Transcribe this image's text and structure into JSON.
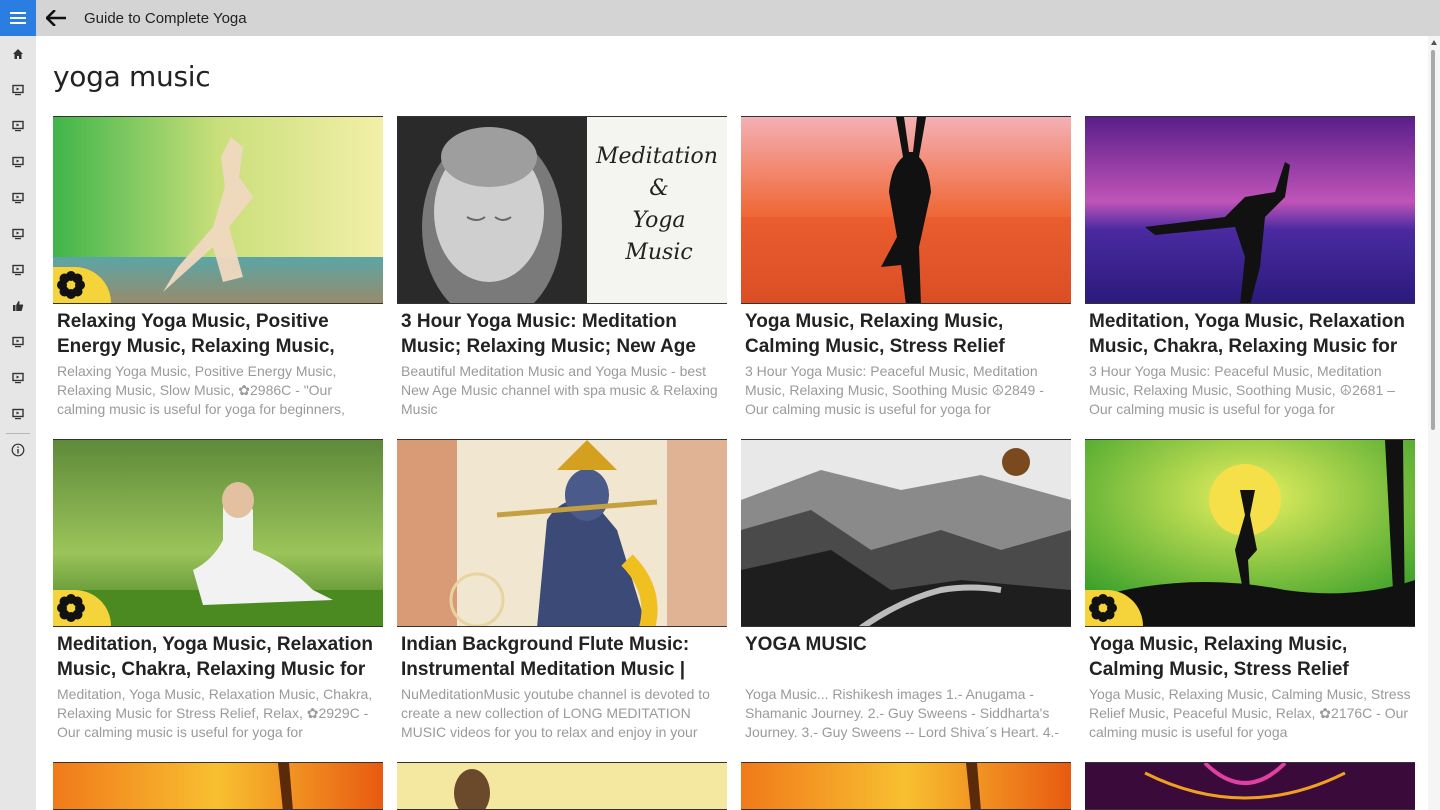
{
  "window": {
    "title": "Guide to Complete Yoga"
  },
  "nav": {
    "icons": [
      "home-icon",
      "video-icon",
      "video-icon",
      "video-icon",
      "video-icon",
      "video-icon",
      "video-icon",
      "thumbs-up-icon",
      "video-icon",
      "video-icon",
      "video-icon",
      "info-icon"
    ]
  },
  "page": {
    "title": "yoga music"
  },
  "cards": [
    {
      "title": "Relaxing Yoga Music, Positive Energy Music, Relaxing Music, Slow",
      "desc": "Relaxing Yoga Music, Positive Energy Music, Relaxing Music, Slow Music, ✿2986C - \"Our calming music is useful for yoga for beginners,"
    },
    {
      "title": "3 Hour Yoga Music: Meditation Music; Relaxing Music; New Age",
      "desc": "Beautiful Meditation Music and Yoga Music - best New Age Music channel with spa music & Relaxing Music"
    },
    {
      "title": "Yoga Music, Relaxing Music, Calming Music, Stress Relief Music,",
      "desc": "3 Hour Yoga Music: Peaceful Music, Meditation Music, Relaxing Music, Soothing Music ☮2849 - Our calming music is useful for yoga for"
    },
    {
      "title": "Meditation, Yoga Music, Relaxation Music, Chakra, Relaxing Music for",
      "desc": "3 Hour Yoga Music: Peaceful Music, Meditation Music, Relaxing Music, Soothing Music, ☮2681 – Our calming music is useful for yoga for"
    },
    {
      "title": "Meditation, Yoga Music, Relaxation Music, Chakra, Relaxing Music for",
      "desc": "Meditation, Yoga Music, Relaxation Music, Chakra, Relaxing Music for Stress Relief, Relax, ✿2929C - Our calming music is useful for yoga for"
    },
    {
      "title": "Indian Background Flute Music: Instrumental Meditation Music |",
      "desc": "NuMeditationMusic youtube channel is devoted to create a new collection of LONG MEDITATION MUSIC videos for you to relax and enjoy in your"
    },
    {
      "title": "YOGA MUSIC",
      "desc": "Yoga Music... Rishikesh images 1.- Anugama - Shamanic Journey. 2.- Guy Sweens - Siddharta's Journey. 3.- Guy Sweens -- Lord Shiva´s Heart. 4.-"
    },
    {
      "title": "Yoga Music, Relaxing Music, Calming Music, Stress Relief Music,",
      "desc": "Yoga Music, Relaxing Music, Calming Music, Stress Relief Music, Peaceful Music, Relax, ✿2176C - Our calming music is useful for yoga"
    }
  ],
  "thumb_texts": {
    "meditation_line1": "Meditation",
    "meditation_line2": "&",
    "meditation_line3": "Yoga",
    "meditation_line4": "Music"
  },
  "colors": {
    "accent": "#2a7de1",
    "badge": "#f4d43a",
    "titlebar": "#d4d4d4",
    "rail": "#e6e6e6"
  }
}
